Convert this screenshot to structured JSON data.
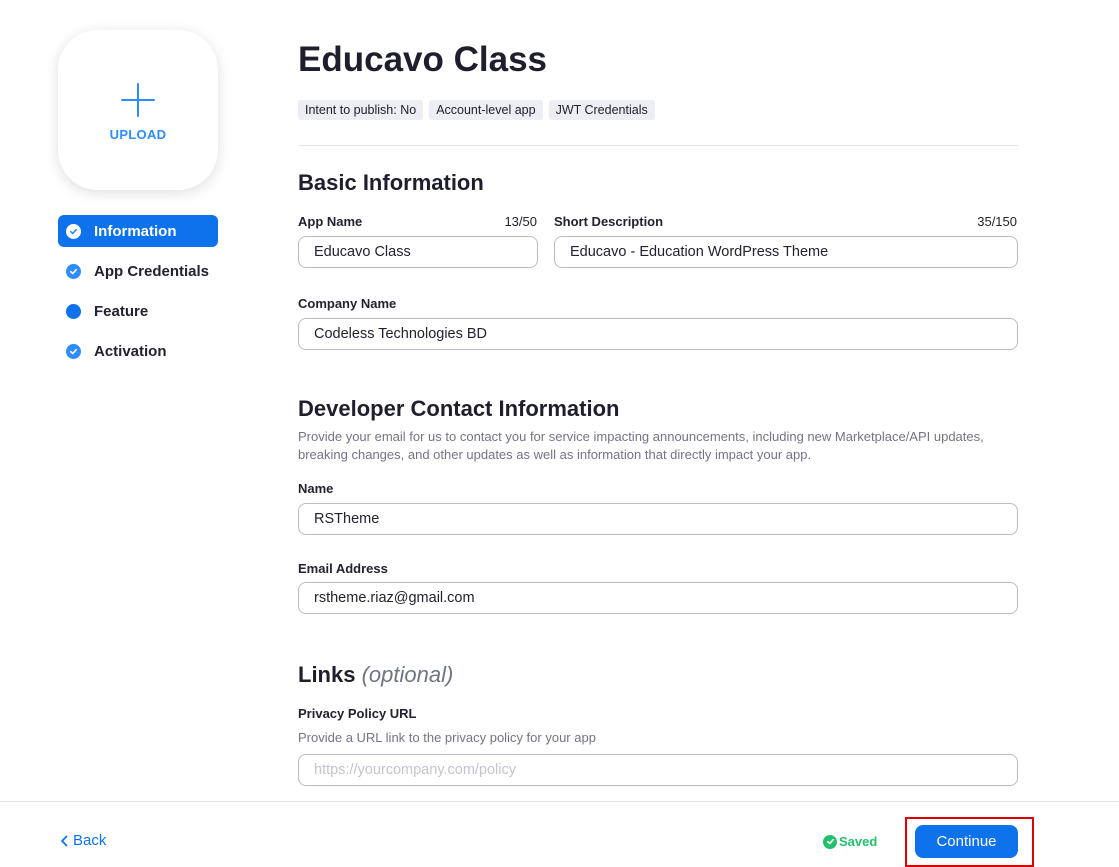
{
  "sidebar": {
    "upload_label": "UPLOAD",
    "nav": [
      {
        "label": "Information",
        "status": "complete",
        "active": true
      },
      {
        "label": "App Credentials",
        "status": "complete",
        "active": false
      },
      {
        "label": "Feature",
        "status": "in-progress",
        "active": false
      },
      {
        "label": "Activation",
        "status": "complete",
        "active": false
      }
    ]
  },
  "header": {
    "title": "Educavo Class",
    "tags": [
      "Intent to publish: No",
      "Account-level app",
      "JWT Credentials"
    ]
  },
  "basic_info": {
    "title": "Basic Information",
    "app_name": {
      "label": "App Name",
      "counter": "13/50",
      "value": "Educavo Class"
    },
    "short_description": {
      "label": "Short Description",
      "counter": "35/150",
      "value": "Educavo - Education WordPress Theme"
    },
    "company_name": {
      "label": "Company Name",
      "value": "Codeless Technologies BD"
    }
  },
  "developer_contact": {
    "title": "Developer Contact Information",
    "description": "Provide your email for us to contact you for service impacting announcements, including new Marketplace/API updates, breaking changes, and other updates as well as information that directly impact your app.",
    "name": {
      "label": "Name",
      "value": "RSTheme"
    },
    "email": {
      "label": "Email Address",
      "value": "rstheme.riaz@gmail.com"
    }
  },
  "links": {
    "title": "Links",
    "optional_label": "(optional)",
    "privacy_policy": {
      "label": "Privacy Policy URL",
      "description": "Provide a URL link to the privacy policy for your app",
      "value": "",
      "placeholder": "https://yourcompany.com/policy"
    }
  },
  "footer": {
    "back_label": "Back",
    "saved_label": "Saved",
    "continue_label": "Continue"
  },
  "colors": {
    "primary": "#0e72ed",
    "accent": "#2d8cff",
    "saved": "#23c16b",
    "highlight": "#e00000"
  }
}
